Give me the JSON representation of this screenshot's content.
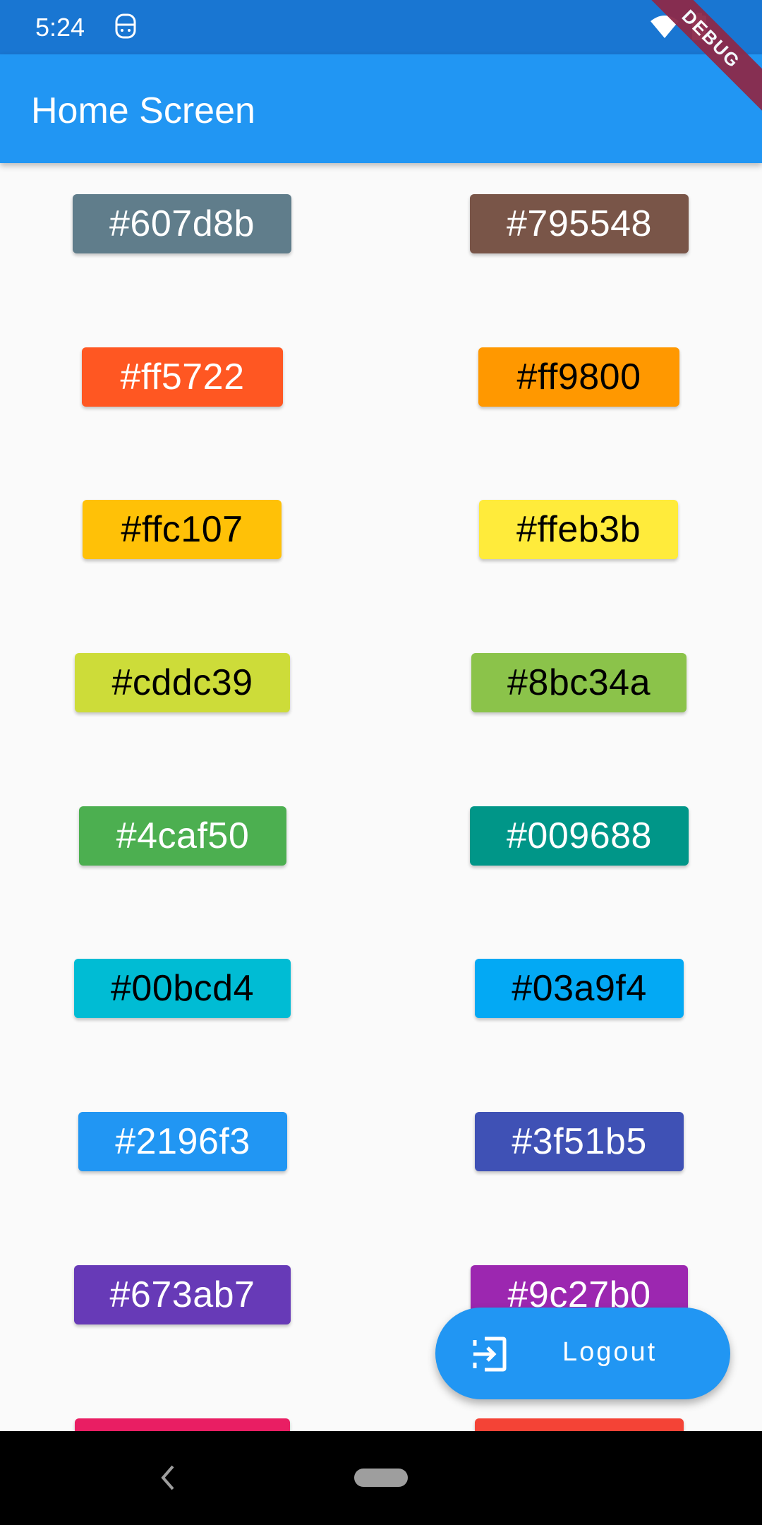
{
  "status_bar": {
    "time": "5:24",
    "icons": [
      "face-icon",
      "wifi-icon",
      "battery-icon"
    ]
  },
  "debug_banner": "DEBUG",
  "app_bar": {
    "title": "Home Screen"
  },
  "color_chips": [
    {
      "label": "#607d8b",
      "bg": "#607d8b",
      "fg": "#ffffff"
    },
    {
      "label": "#795548",
      "bg": "#795548",
      "fg": "#ffffff"
    },
    {
      "label": "#ff5722",
      "bg": "#ff5722",
      "fg": "#ffffff"
    },
    {
      "label": "#ff9800",
      "bg": "#ff9800",
      "fg": "#000000"
    },
    {
      "label": "#ffc107",
      "bg": "#ffc107",
      "fg": "#000000"
    },
    {
      "label": "#ffeb3b",
      "bg": "#ffeb3b",
      "fg": "#000000"
    },
    {
      "label": "#cddc39",
      "bg": "#cddc39",
      "fg": "#000000"
    },
    {
      "label": "#8bc34a",
      "bg": "#8bc34a",
      "fg": "#000000"
    },
    {
      "label": "#4caf50",
      "bg": "#4caf50",
      "fg": "#ffffff"
    },
    {
      "label": "#009688",
      "bg": "#009688",
      "fg": "#ffffff"
    },
    {
      "label": "#00bcd4",
      "bg": "#00bcd4",
      "fg": "#000000"
    },
    {
      "label": "#03a9f4",
      "bg": "#03a9f4",
      "fg": "#000000"
    },
    {
      "label": "#2196f3",
      "bg": "#2196f3",
      "fg": "#ffffff"
    },
    {
      "label": "#3f51b5",
      "bg": "#3f51b5",
      "fg": "#ffffff"
    },
    {
      "label": "#673ab7",
      "bg": "#673ab7",
      "fg": "#ffffff"
    },
    {
      "label": "#9c27b0",
      "bg": "#9c27b0",
      "fg": "#ffffff"
    },
    {
      "label": "",
      "bg": "#e91e63",
      "fg": "#ffffff"
    },
    {
      "label": "",
      "bg": "#f44336",
      "fg": "#ffffff"
    }
  ],
  "fab": {
    "label": "Logout",
    "icon": "logout-icon"
  },
  "nav_bar": {
    "icons": [
      "back-icon",
      "home-pill-icon"
    ]
  }
}
